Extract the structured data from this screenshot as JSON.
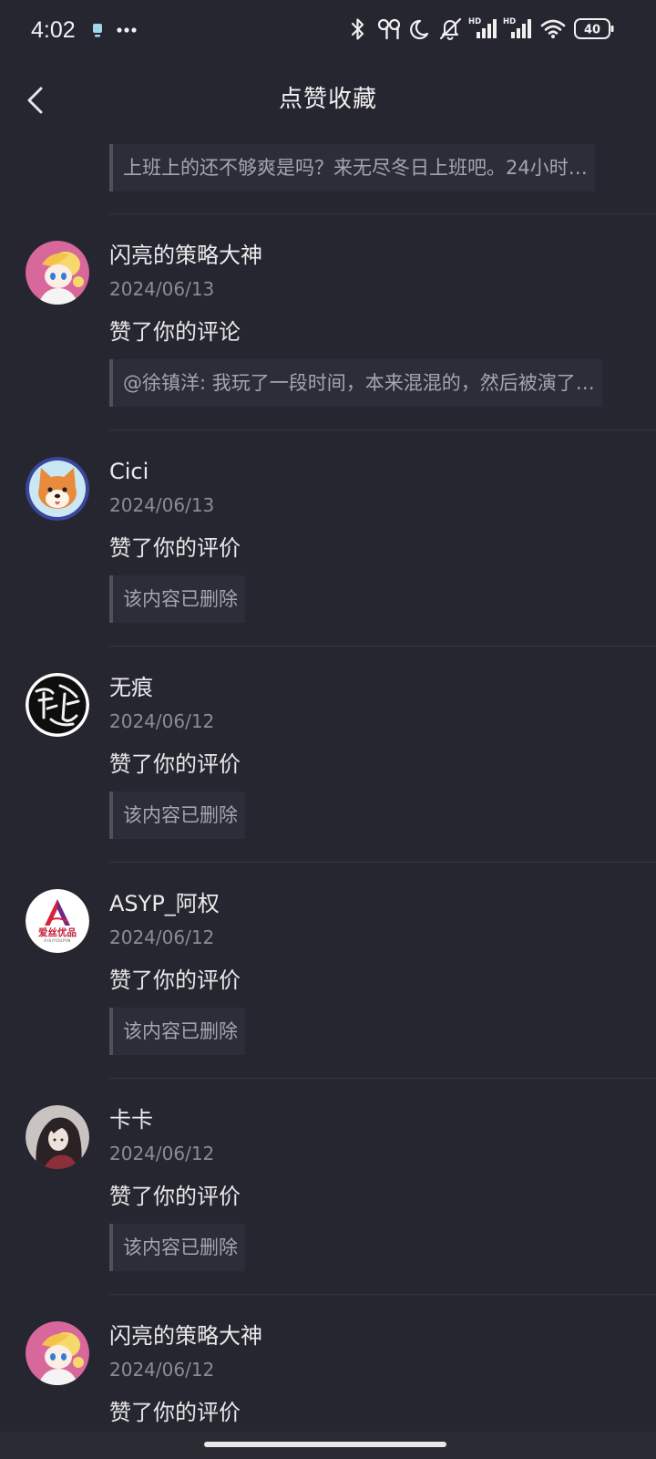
{
  "status_bar": {
    "time": "4:02",
    "network_label_1": "HD",
    "network_label_2": "HD",
    "battery_level": "40",
    "icons": [
      "app-notification-icon",
      "more-notifications-icon",
      "bluetooth-icon",
      "earbuds-icon",
      "moon-icon",
      "mute-bell-icon",
      "signal-icon",
      "signal-icon",
      "wifi-icon",
      "battery-icon"
    ]
  },
  "header": {
    "title": "点赞收藏",
    "back_icon": "chevron-left-icon"
  },
  "top_item": {
    "quote": "上班上的还不够爽是吗？来无尽冬日上班吧。24小时…"
  },
  "items": [
    {
      "name": "闪亮的策略大神",
      "date": "2024/06/13",
      "action": "赞了你的评论",
      "quote": "@徐镇洋: 我玩了一段时间，本来混混的，然后被演了…"
    },
    {
      "name": "Cici",
      "date": "2024/06/13",
      "action": "赞了你的评价",
      "quote": "该内容已删除"
    },
    {
      "name": "无痕",
      "date": "2024/06/12",
      "action": "赞了你的评价",
      "quote": "该内容已删除"
    },
    {
      "name": "ASYP_阿权",
      "date": "2024/06/12",
      "action": "赞了你的评价",
      "quote": "该内容已删除",
      "avatar_logo_text": "爱丝优品",
      "avatar_logo_sub": "AISIYOUPIN"
    },
    {
      "name": "卡卡",
      "date": "2024/06/12",
      "action": "赞了你的评价",
      "quote": "该内容已删除"
    },
    {
      "name": "闪亮的策略大神",
      "date": "2024/06/12",
      "action": "赞了你的评价"
    }
  ],
  "colors": {
    "background": "#252630",
    "quote_background": "#2c2d38",
    "quote_bar": "#4f505b",
    "divider": "#34353f",
    "text_primary": "#ebebeb",
    "text_secondary": "#8b8c96",
    "quote_text": "#a4a5af"
  }
}
